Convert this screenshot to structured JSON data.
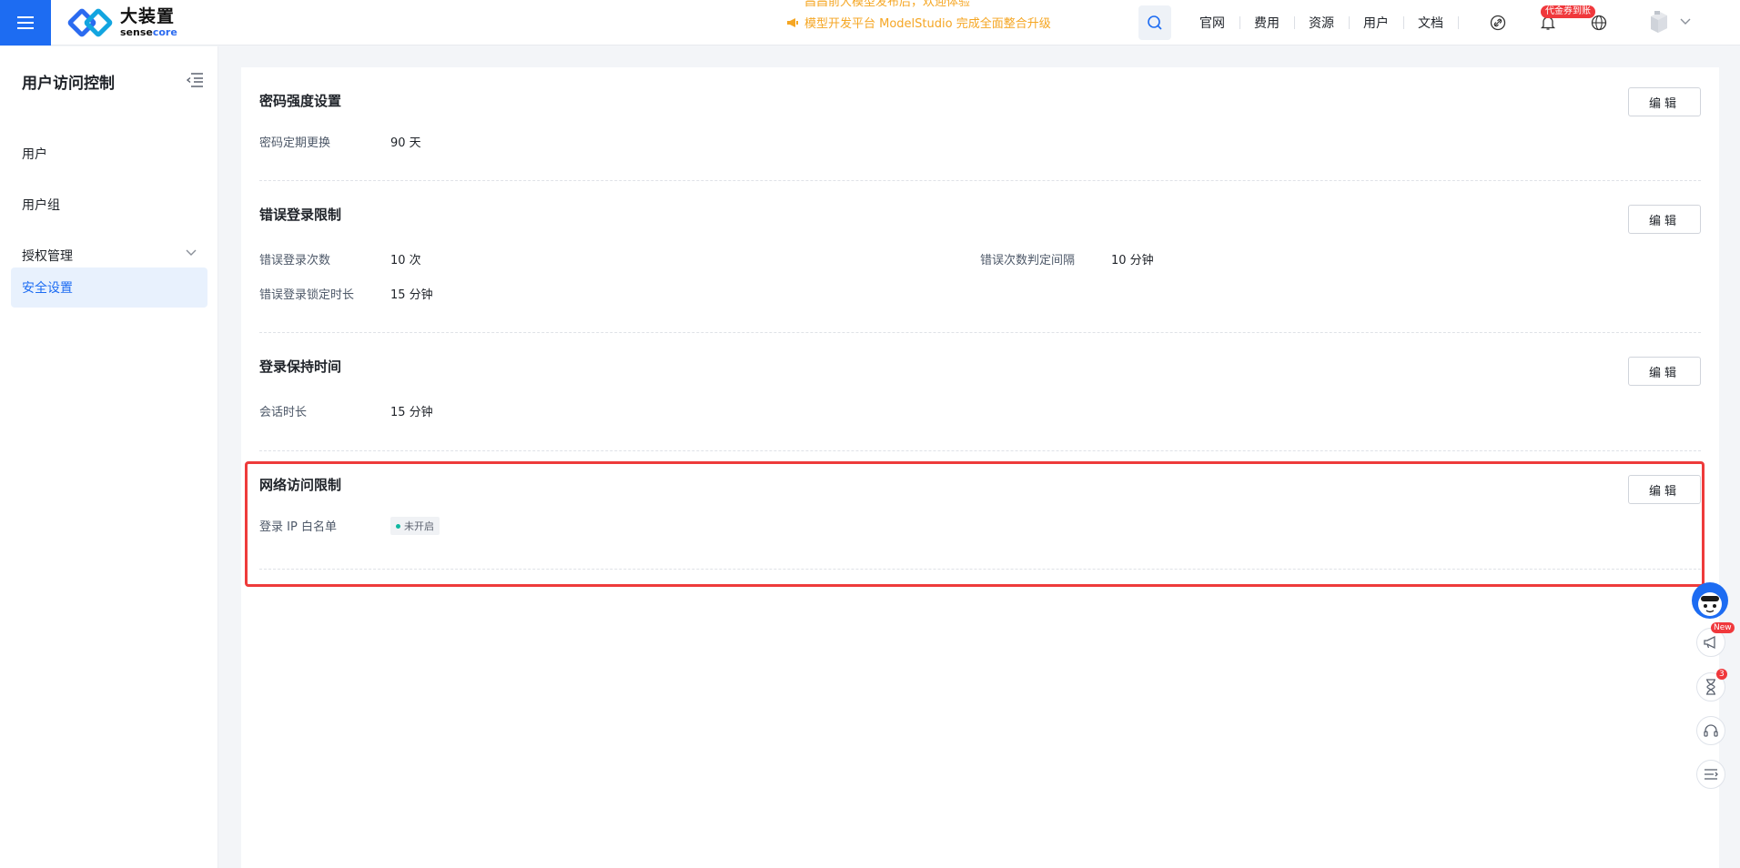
{
  "header": {
    "logo_cn": "大装置",
    "logo_en_prefix": "sense",
    "logo_en_suffix": "core",
    "notice_line1": "昌昌前大模型发布后，欢迎体验",
    "notice_line2": "模型开发平台 ModelStudio 完成全面整合升级",
    "nav": [
      "官网",
      "费用",
      "资源",
      "用户",
      "文档"
    ],
    "coupon_badge": "代金券到账"
  },
  "sidebar": {
    "title": "用户访问控制",
    "items": [
      {
        "label": "用户"
      },
      {
        "label": "用户组"
      },
      {
        "label": "授权管理"
      },
      {
        "label": "安全设置"
      }
    ]
  },
  "sections": {
    "password": {
      "title": "密码强度设置",
      "edit": "编辑",
      "rotate_label": "密码定期更换",
      "rotate_value": "90 天"
    },
    "login_error": {
      "title": "错误登录限制",
      "edit": "编辑",
      "count_label": "错误登录次数",
      "count_value": "10 次",
      "interval_label": "错误次数判定间隔",
      "interval_value": "10 分钟",
      "lock_label": "错误登录锁定时长",
      "lock_value": "15 分钟"
    },
    "session": {
      "title": "登录保持时间",
      "edit": "编辑",
      "duration_label": "会话时长",
      "duration_value": "15 分钟"
    },
    "network": {
      "title": "网络访问限制",
      "edit": "编辑",
      "whitelist_label": "登录 IP 白名单",
      "whitelist_status": "未开启"
    }
  },
  "float_tools": {
    "new_badge": "New",
    "task_badge": "3"
  },
  "colors": {
    "primary": "#1d6cf2",
    "highlight": "#ee3b3b",
    "notice": "#f5a623"
  }
}
